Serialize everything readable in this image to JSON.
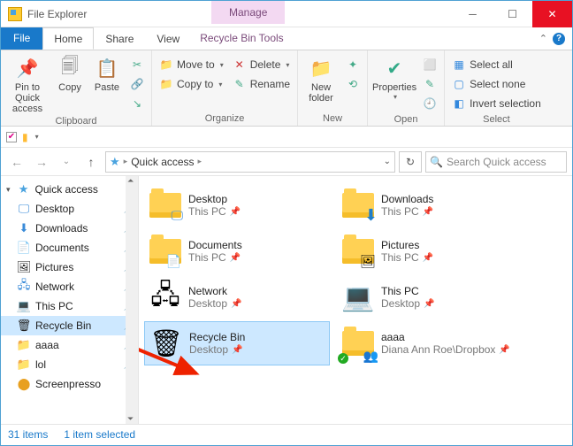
{
  "window": {
    "title": "File Explorer",
    "context_tab": "Manage"
  },
  "tabs": {
    "file": "File",
    "home": "Home",
    "share": "Share",
    "view": "View",
    "tools": "Recycle Bin Tools"
  },
  "ribbon": {
    "clipboard": {
      "label": "Clipboard",
      "pin": "Pin to Quick\naccess",
      "copy": "Copy",
      "paste": "Paste"
    },
    "organize": {
      "label": "Organize",
      "move_to": "Move to",
      "copy_to": "Copy to",
      "delete": "Delete",
      "rename": "Rename"
    },
    "new": {
      "label": "New",
      "new_folder": "New\nfolder"
    },
    "open": {
      "label": "Open",
      "properties": "Properties"
    },
    "select": {
      "label": "Select",
      "select_all": "Select all",
      "select_none": "Select none",
      "invert": "Invert selection"
    }
  },
  "address": {
    "root": "Quick access",
    "search_placeholder": "Search Quick access"
  },
  "sidebar": {
    "header": "Quick access",
    "items": [
      {
        "label": "Desktop",
        "icon": "desktop"
      },
      {
        "label": "Downloads",
        "icon": "downloads"
      },
      {
        "label": "Documents",
        "icon": "documents"
      },
      {
        "label": "Pictures",
        "icon": "pictures"
      },
      {
        "label": "Network",
        "icon": "network"
      },
      {
        "label": "This PC",
        "icon": "thispc"
      },
      {
        "label": "Recycle Bin",
        "icon": "recycle"
      },
      {
        "label": "aaaa",
        "icon": "folder"
      },
      {
        "label": "lol",
        "icon": "folder"
      },
      {
        "label": "Screenpresso",
        "icon": "screenpresso"
      }
    ]
  },
  "tiles": [
    {
      "name": "Desktop",
      "sub": "This PC",
      "icon": "desktop"
    },
    {
      "name": "Downloads",
      "sub": "This PC",
      "icon": "downloads"
    },
    {
      "name": "Documents",
      "sub": "This PC",
      "icon": "documents"
    },
    {
      "name": "Pictures",
      "sub": "This PC",
      "icon": "pictures"
    },
    {
      "name": "Network",
      "sub": "Desktop",
      "icon": "network"
    },
    {
      "name": "This PC",
      "sub": "Desktop",
      "icon": "thispc"
    },
    {
      "name": "Recycle Bin",
      "sub": "Desktop",
      "icon": "recycle",
      "selected": true
    },
    {
      "name": "aaaa",
      "sub": "Diana Ann Roe\\Dropbox",
      "icon": "shared"
    }
  ],
  "status": {
    "count": "31 items",
    "selected": "1 item selected"
  }
}
